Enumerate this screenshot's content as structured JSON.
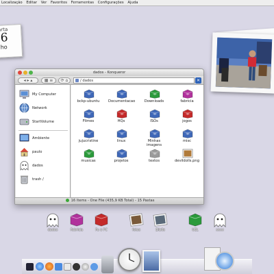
{
  "menubar": {
    "items": [
      "Localização",
      "Editar",
      "Ver",
      "Favoritos",
      "Ferramentas",
      "Configurações",
      "Ajuda"
    ]
  },
  "calendar": {
    "weekday": "arta",
    "day": "6",
    "month": "lho"
  },
  "window": {
    "title": "dados - Konqueror",
    "location": "/ dados",
    "status": "16 Items - One File (435,9 KB Total) - 15 Pastas",
    "sidebar": [
      {
        "label": "My Computer",
        "icon": "computer-icon"
      },
      {
        "label": "Network",
        "icon": "globe-icon"
      },
      {
        "label": "StartVolume",
        "icon": "hard-drive-icon"
      },
      {
        "label": "Ambiente",
        "icon": "desktop-icon"
      },
      {
        "label": "paulo",
        "icon": "home-icon"
      },
      {
        "label": "dados",
        "icon": "ghost-icon"
      },
      {
        "label": "trash /",
        "icon": "trash-icon"
      }
    ],
    "files": [
      {
        "name": "bckp-ubuntu",
        "color": "#3f68b8"
      },
      {
        "name": "Documentacao",
        "color": "#3f68b8"
      },
      {
        "name": "Downloads",
        "color": "#2b9a3b"
      },
      {
        "name": "fabricia",
        "color": "#b1329c"
      },
      {
        "name": "Filmes",
        "color": "#3f68b8"
      },
      {
        "name": "HQs",
        "color": "#c42a2a"
      },
      {
        "name": "ISOs",
        "color": "#3f68b8"
      },
      {
        "name": "jogos",
        "color": "#c42a2a"
      },
      {
        "name": "jujucristine",
        "color": "#3f68b8"
      },
      {
        "name": "linux",
        "color": "#3f68b8"
      },
      {
        "name": "Minhas imagens",
        "color": "#3f68b8"
      },
      {
        "name": "misc",
        "color": "#3f68b8"
      },
      {
        "name": "musicas",
        "color": "#2b9a3b"
      },
      {
        "name": "projetos",
        "color": "#3f68b8"
      },
      {
        "name": "textos",
        "color": "#9a9a9a"
      },
      {
        "name": "devildolls.png",
        "color": "#b07a3a"
      }
    ]
  },
  "desktop_icons": [
    {
      "label": "dados",
      "icon": "ghost-icon",
      "color": "#ffffff"
    },
    {
      "label": "Fabricia",
      "icon": "folder-icon",
      "color": "#b1329c"
    },
    {
      "label": "Fu e PC",
      "icon": "folder-icon",
      "color": "#c42a2a"
    },
    {
      "label": "fotos",
      "icon": "photo-icon",
      "color": "#7a5a3a"
    },
    {
      "label": "Eliz0s",
      "icon": "photo-icon",
      "color": "#5a6a7a"
    },
    {
      "label": "UEL",
      "icon": "folder-icon",
      "color": "#2b9a3b"
    },
    {
      "label": "xxxx",
      "icon": "ghost-icon",
      "color": "#ffffff"
    }
  ]
}
